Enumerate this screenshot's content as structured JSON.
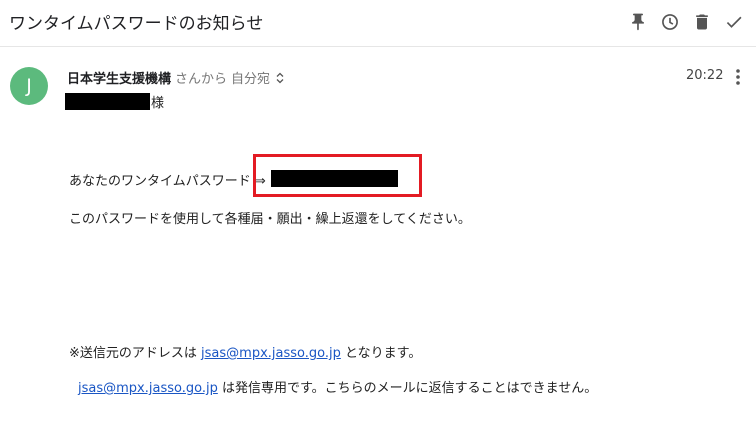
{
  "email": {
    "subject": "ワンタイムパスワードのお知らせ",
    "sender": {
      "avatar_letter": "J",
      "name": "日本学生支援機構",
      "from_suffix": "さんから",
      "recipient": "自分宛"
    },
    "time": "20:22",
    "body": {
      "honorific": "様",
      "otp_label": "あなたのワンタイムパスワード ⇒",
      "instructions": "このパスワードを使用して各種届・願出・繰上返還をしてください。",
      "note_prefix": "※送信元のアドレスは",
      "note_email": "jsas@mpx.jasso.go.jp",
      "note_suffix": "となります。",
      "sendonly_email": "jsas@mpx.jasso.go.jp",
      "sendonly_text": "は発信専用です。こちらのメールに返信することはできません。"
    }
  },
  "toolbar": {
    "icons": [
      "pin-icon",
      "clock-icon",
      "trash-icon",
      "check-icon"
    ]
  },
  "colors": {
    "avatar": "#5cba7d",
    "highlight_border": "#e31b23",
    "link": "#1a56c4"
  }
}
